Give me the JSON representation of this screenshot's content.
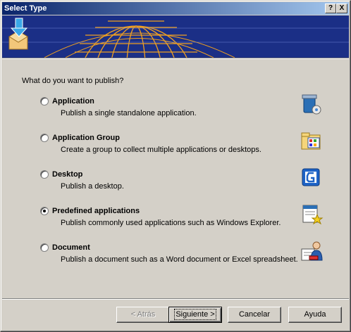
{
  "window": {
    "title": "Select Type",
    "help_btn": "?",
    "close_btn": "X"
  },
  "prompt": "What do you want to publish?",
  "options": [
    {
      "label": "Application",
      "desc": "Publish a single standalone application.",
      "selected": false,
      "icon": "application-icon"
    },
    {
      "label": "Application Group",
      "desc": "Create a group to collect multiple applications or desktops.",
      "selected": false,
      "icon": "application-group-icon"
    },
    {
      "label": "Desktop",
      "desc": "Publish a desktop.",
      "selected": false,
      "icon": "desktop-icon"
    },
    {
      "label": "Predefined applications",
      "desc": "Publish commonly used applications such as Windows Explorer.",
      "selected": true,
      "icon": "predefined-applications-icon"
    },
    {
      "label": "Document",
      "desc": "Publish a document such as a Word document or Excel spreadsheet.",
      "selected": false,
      "icon": "document-icon"
    }
  ],
  "buttons": {
    "back": "< Atrás",
    "next": "Siguiente >",
    "cancel": "Cancelar",
    "help": "Ayuda"
  },
  "colors": {
    "title_start": "#0a246a",
    "title_end": "#a6caf0",
    "banner_bg": "#1b2f86",
    "globe": "#f0a020"
  }
}
